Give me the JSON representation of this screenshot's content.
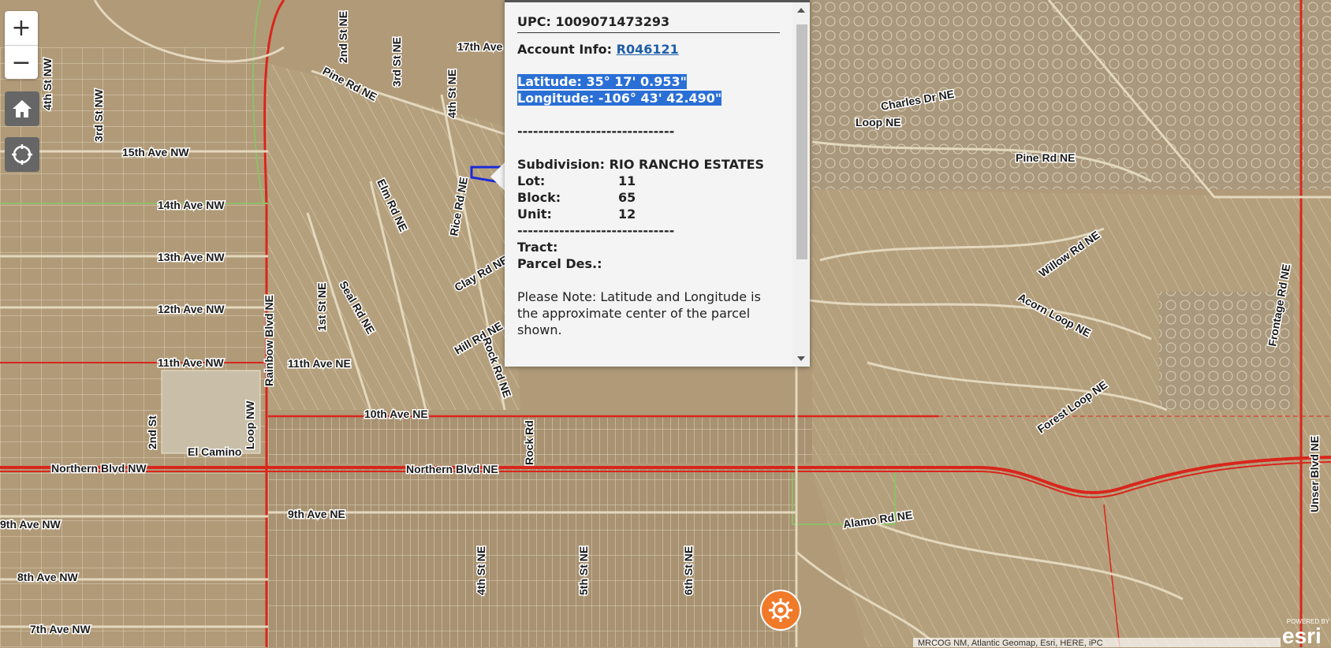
{
  "map": {
    "colors": {
      "terrain": "#b09a78",
      "parcel_line": "#efe6cf",
      "major_road": "#d8261c",
      "minor_road": "#8fbf6a",
      "selected_parcel": "#1a2bd6"
    },
    "street_labels": [
      "2nd St NE",
      "3rd St NE",
      "17th Ave",
      "4th St NE",
      "Pine Rd NE",
      "4th St NW",
      "3rd St NW",
      "15th Ave NW",
      "14th Ave NW",
      "13th Ave NW",
      "12th Ave NW",
      "11th Ave NW",
      "11th Ave NE",
      "Rainbow Blvd NE",
      "1st St NE",
      "Seal Rd NE",
      "Elm Rd NE",
      "Rice Rd NE",
      "Clay Rd NE",
      "Hill Rd NE",
      "Rock Rd NE",
      "2nd St",
      "Loop NW",
      "El Camino",
      "10th Ave NE",
      "Northern Blvd NW",
      "Northern Blvd NE",
      "Rock Rd",
      "9th Ave NE",
      "9th Ave NW",
      "8th Ave NW",
      "7th Ave NW",
      "4th St NE",
      "5th St NE",
      "6th St NE",
      "Charles Dr NE",
      "Pine Rd NE",
      "Willow Rd NE",
      "Acorn Loop NE",
      "Forest Loop NE",
      "Alamo Rd NE",
      "Unser Blvd NE",
      "Frontage Rd NE",
      "Loop NE"
    ]
  },
  "controls": {
    "zoom_in": "+",
    "zoom_out": "−",
    "home_icon": "home-icon",
    "locate_icon": "locate-icon"
  },
  "popup": {
    "upc_label": "UPC:",
    "upc_value": "1009071473293",
    "account_label": "Account Info:",
    "account_value": "R046121",
    "latitude": "Latitude: 35° 17' 0.953\"",
    "longitude": "Longitude: -106° 43' 42.490\"",
    "divider": "------------------------------",
    "subdivision_label": "Subdivision:",
    "subdivision_value": "RIO RANCHO ESTATES",
    "lot_label": "Lot:",
    "lot_value": "11",
    "block_label": "Block:",
    "block_value": "65",
    "unit_label": "Unit:",
    "unit_value": "12",
    "tract_label": "Tract:",
    "parcel_des_label": "Parcel Des.:",
    "note": "Please Note: Latitude and Longitude is the approximate center of the parcel shown."
  },
  "footer": {
    "attribution": "MRCOG NM, Atlantic Geomap, Esri, HERE, iPC",
    "powered_by": "POWERED BY",
    "esri": "esri"
  }
}
